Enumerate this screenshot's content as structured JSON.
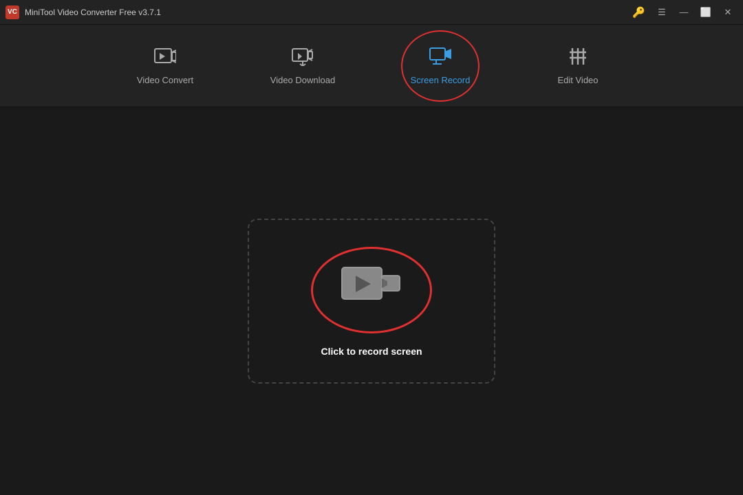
{
  "titleBar": {
    "title": "MiniTool Video Converter Free v3.7.1",
    "logoText": "VC",
    "controls": {
      "key": "🔑",
      "minimize": "—",
      "maximize": "⬜",
      "close": "✕"
    }
  },
  "nav": {
    "tabs": [
      {
        "id": "video-convert",
        "label": "Video Convert",
        "icon": "convert",
        "active": false
      },
      {
        "id": "video-download",
        "label": "Video Download",
        "icon": "download",
        "active": false
      },
      {
        "id": "screen-record",
        "label": "Screen Record",
        "icon": "record",
        "active": true
      },
      {
        "id": "edit-video",
        "label": "Edit Video",
        "icon": "edit",
        "active": false
      }
    ]
  },
  "main": {
    "recordArea": {
      "ctaLabel": "Click to record screen"
    }
  }
}
